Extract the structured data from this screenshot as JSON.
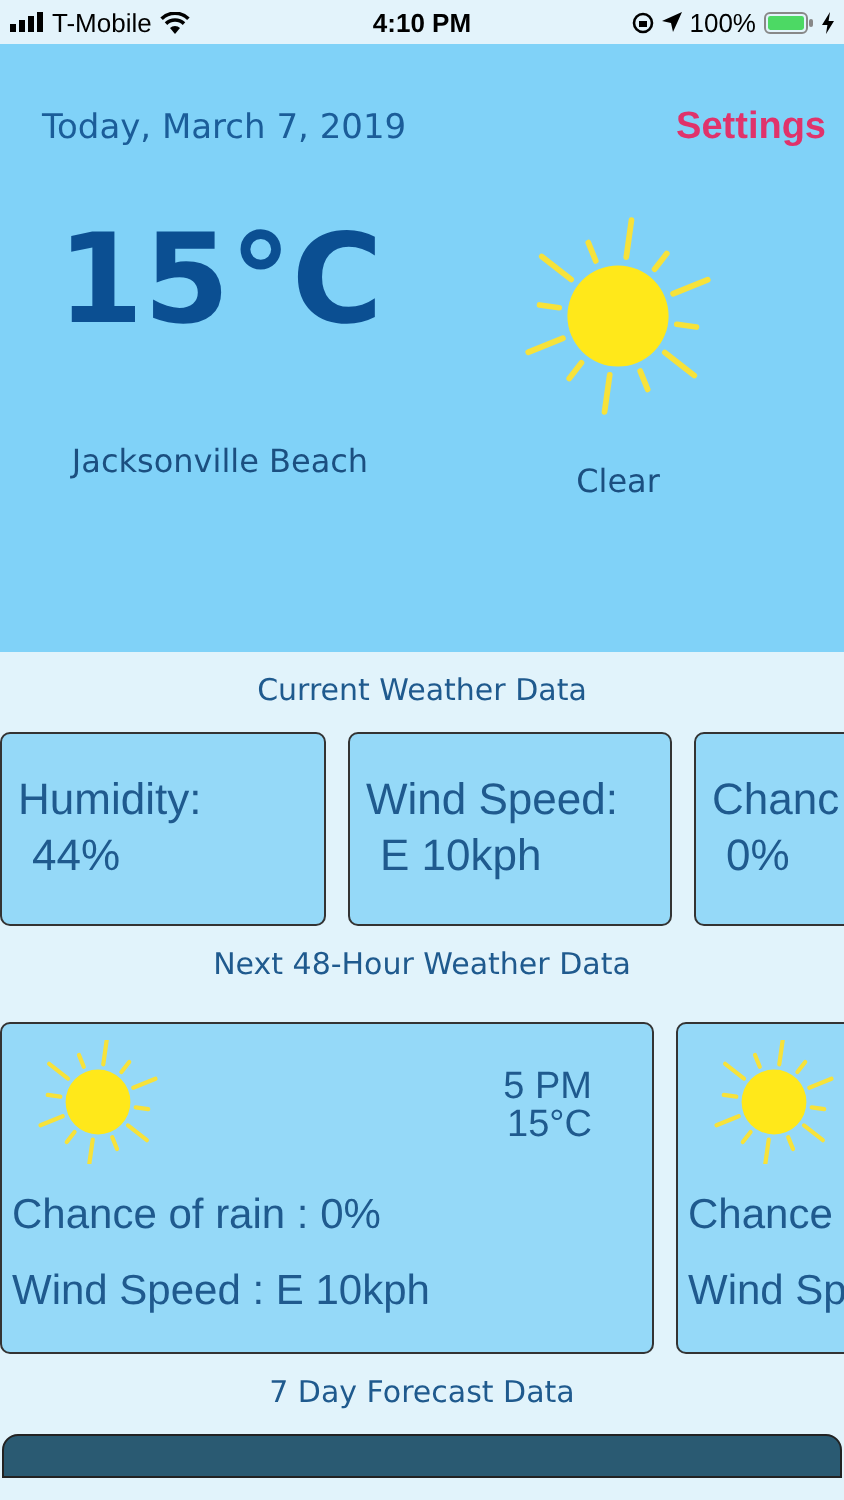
{
  "status_bar": {
    "carrier": "T-Mobile",
    "time": "4:10 PM",
    "battery": "100%"
  },
  "header": {
    "date": "Today, March 7, 2019",
    "settings": "Settings",
    "temperature": "15°C",
    "kind": "sun",
    "condition": "Clear",
    "location": "Jacksonville Beach"
  },
  "current": {
    "title": "Current Weather Data",
    "cards": [
      {
        "label": "Humidity:",
        "value": "44%"
      },
      {
        "label": "Wind Speed:",
        "value": "E 10kph"
      },
      {
        "label": "Chanc",
        "value": "0%"
      }
    ]
  },
  "hourly": {
    "title": "Next 48-Hour Weather Data",
    "cards": [
      {
        "kind": "sun",
        "time": "5 PM",
        "temp": "15°C",
        "rain": "Chance of rain : 0%",
        "wind": "Wind Speed : E 10kph"
      },
      {
        "kind": "sun",
        "rain": "Chance",
        "wind": "Wind Sp"
      }
    ]
  },
  "forecast": {
    "title": "7 Day Forecast Data"
  }
}
